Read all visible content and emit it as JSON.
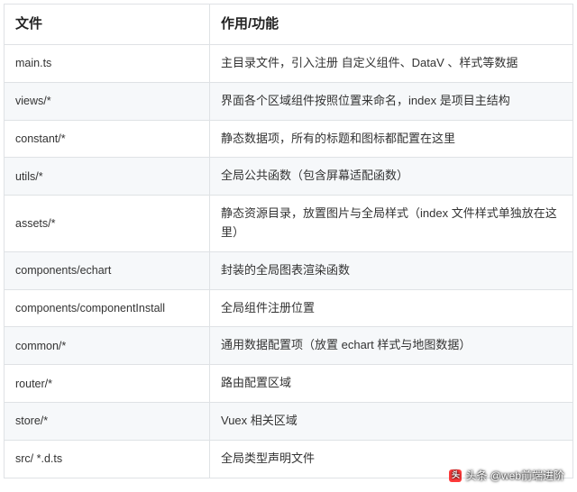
{
  "table": {
    "headers": {
      "file": "文件",
      "desc": "作用/功能"
    },
    "rows": [
      {
        "file": "main.ts",
        "desc": "主目录文件，引入注册 自定义组件、DataV 、样式等数据"
      },
      {
        "file": "views/*",
        "desc": "界面各个区域组件按照位置来命名，index 是项目主结构"
      },
      {
        "file": "constant/*",
        "desc": "静态数据项，所有的标题和图标都配置在这里"
      },
      {
        "file": "utils/*",
        "desc": "全局公共函数（包含屏幕适配函数）"
      },
      {
        "file": "assets/*",
        "desc": "静态资源目录，放置图片与全局样式（index 文件样式单独放在这里）"
      },
      {
        "file": "components/echart",
        "desc": "封装的全局图表渲染函数"
      },
      {
        "file": "components/componentInstall",
        "desc": "全局组件注册位置"
      },
      {
        "file": "common/*",
        "desc": "通用数据配置项（放置 echart 样式与地图数据）"
      },
      {
        "file": "router/*",
        "desc": "路由配置区域"
      },
      {
        "file": "store/*",
        "desc": "Vuex 相关区域"
      },
      {
        "file": "src/ *.d.ts",
        "desc": "全局类型声明文件"
      }
    ]
  },
  "watermark": {
    "icon_text": "头",
    "label": "头条 @web前端进阶"
  }
}
